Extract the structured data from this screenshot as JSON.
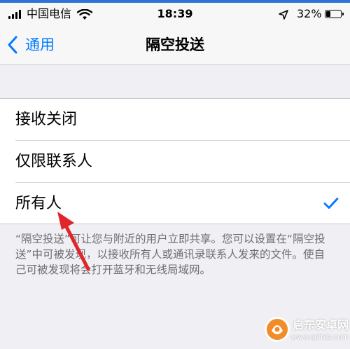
{
  "status_bar": {
    "carrier": "中国电信",
    "time": "18:39",
    "battery_percent": "32%",
    "battery_level": 0.32,
    "icons": [
      "signal-icon",
      "wifi-icon",
      "location-icon",
      "battery-icon"
    ]
  },
  "nav": {
    "back_label": "通用",
    "title": "隔空投送",
    "accent_color": "#007aff"
  },
  "options": [
    {
      "label": "接收关闭",
      "selected": false
    },
    {
      "label": "仅限联系人",
      "selected": false
    },
    {
      "label": "所有人",
      "selected": true
    }
  ],
  "footer": {
    "description": "“隔空投送”可让您与附近的用户立即共享。您可以设置在“隔空投送”中可被发现，以接收所有人或通讯录联系人发来的文件。使自己可被发现将会打开蓝牙和无线局域网。"
  },
  "watermark": {
    "name": "启东安卓网",
    "url": "www.qdltdz.com"
  }
}
